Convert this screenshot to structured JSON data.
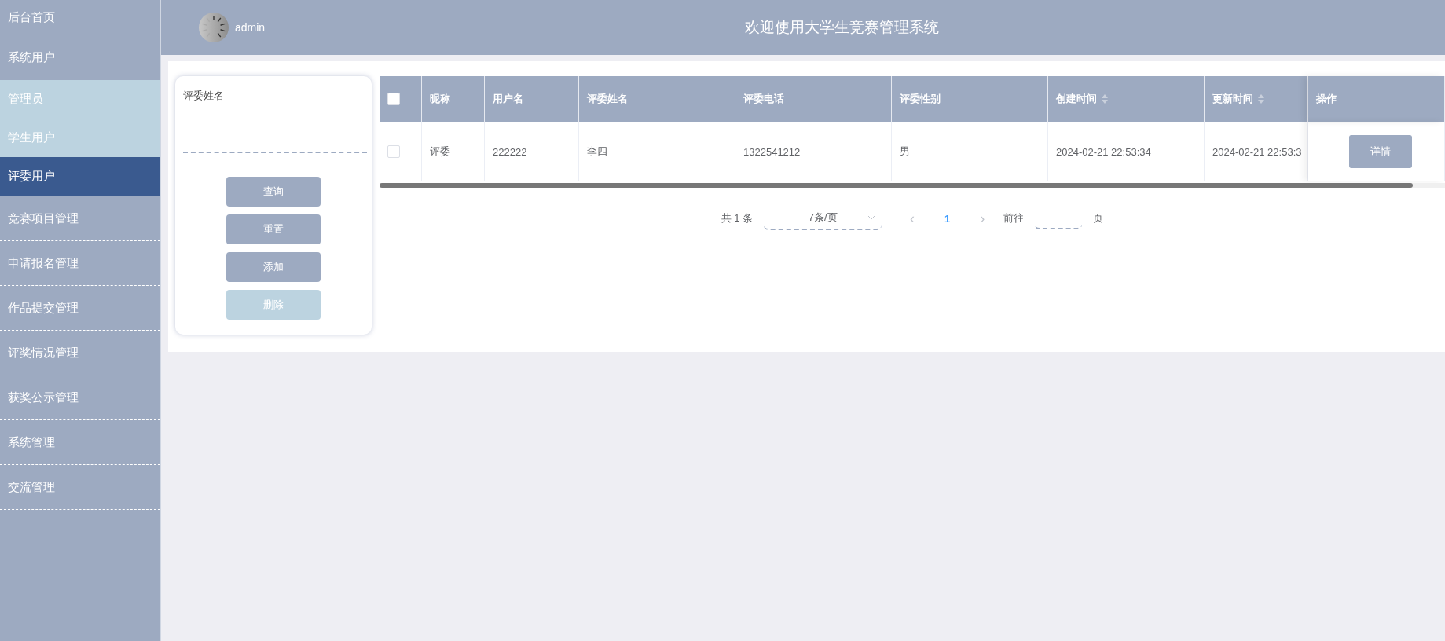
{
  "sidebar": {
    "items": [
      {
        "label": "后台首页",
        "selected": false
      },
      {
        "label": "系统用户",
        "selected": false,
        "expanded": true,
        "children": [
          {
            "label": "管理员",
            "selected": false
          },
          {
            "label": "学生用户",
            "selected": false
          },
          {
            "label": "评委用户",
            "selected": true
          }
        ]
      },
      {
        "label": "竞赛项目管理",
        "selected": false
      },
      {
        "label": "申请报名管理",
        "selected": false
      },
      {
        "label": "作品提交管理",
        "selected": false
      },
      {
        "label": "评奖情况管理",
        "selected": false
      },
      {
        "label": "获奖公示管理",
        "selected": false
      },
      {
        "label": "系统管理",
        "selected": false
      },
      {
        "label": "交流管理",
        "selected": false
      }
    ]
  },
  "header": {
    "user": "admin",
    "title": "欢迎使用大学生竞赛管理系统"
  },
  "filter": {
    "label": "评委姓名",
    "buttons": [
      {
        "label": "查询",
        "disabled": false
      },
      {
        "label": "重置",
        "disabled": false
      },
      {
        "label": "添加",
        "disabled": false
      },
      {
        "label": "删除",
        "disabled": true
      }
    ]
  },
  "table": {
    "select_all": {
      "checked": false
    },
    "columns": [
      {
        "label": "昵称",
        "sortable": false
      },
      {
        "label": "用户名",
        "sortable": false
      },
      {
        "label": "评委姓名",
        "sortable": false
      },
      {
        "label": "评委电话",
        "sortable": false
      },
      {
        "label": "评委性别",
        "sortable": false
      },
      {
        "label": "创建时间",
        "sortable": true
      },
      {
        "label": "更新时间",
        "sortable": true
      },
      {
        "label": "操作",
        "sortable": false
      }
    ],
    "rows": [
      {
        "checked": false,
        "cells": [
          "评委",
          "222222",
          "李四",
          "1322541212",
          "男",
          "2024-02-21 22:53:34",
          "2024-02-21 22:53:3"
        ],
        "action": "详情"
      }
    ]
  },
  "pagination": {
    "total": "共 1 条",
    "page_size": "7条/页",
    "pages": [
      {
        "label": "1",
        "selected": true
      }
    ],
    "prev": "‹",
    "next": "›",
    "goto": "前往",
    "goto_suffix": "页"
  }
}
